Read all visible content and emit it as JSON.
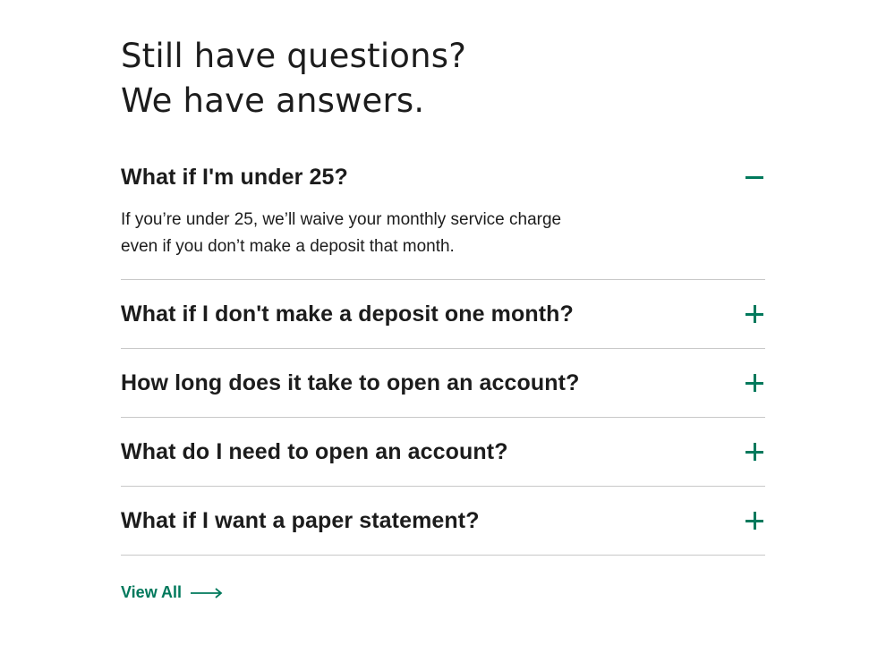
{
  "faq": {
    "heading_line1": "Still have questions?",
    "heading_line2": "We have answers.",
    "items": [
      {
        "question": "What if I'm under 25?",
        "answer": "If you’re under 25, we’ll waive your monthly service charge even if you don’t make a deposit that month.",
        "expanded": true,
        "toggle_icon": "minus-icon"
      },
      {
        "question": "What if I don't make a deposit one month?",
        "expanded": false,
        "toggle_icon": "plus-icon"
      },
      {
        "question": "How long does it take to open an account?",
        "expanded": false,
        "toggle_icon": "plus-icon"
      },
      {
        "question": "What do I need to open an account?",
        "expanded": false,
        "toggle_icon": "plus-icon"
      },
      {
        "question": "What if I want a paper statement?",
        "expanded": false,
        "toggle_icon": "plus-icon"
      }
    ],
    "view_all_label": "View All",
    "view_all_icon": "arrow-right-icon"
  },
  "colors": {
    "accent": "#00795c",
    "text": "#1c1c1c",
    "divider": "#c8c8c8"
  }
}
